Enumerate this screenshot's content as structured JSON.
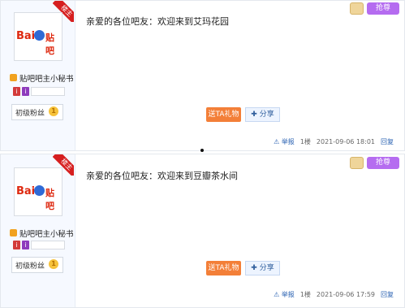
{
  "posts": [
    {
      "user_role_ribbon": "楼主",
      "avatar_logo": {
        "text1": "Bai",
        "text2": "贴吧"
      },
      "user_title": "贴吧吧主小秘书",
      "badges": [
        "i",
        "i"
      ],
      "rank": "初级粉丝",
      "rank_level": "1",
      "content": "亲爱的各位吧友：欢迎来到艾玛花园",
      "actions": {
        "gift": "送TA礼物",
        "share": "分享"
      },
      "footer": {
        "report": "举报",
        "floor": "1楼",
        "time": "2021-09-06 18:01",
        "reply": "回复"
      },
      "top_icons": {
        "vip": "抢尊"
      }
    },
    {
      "user_role_ribbon": "楼主",
      "avatar_logo": {
        "text1": "Bai",
        "text2": "贴吧"
      },
      "user_title": "贴吧吧主小秘书",
      "badges": [
        "i",
        "i"
      ],
      "rank": "初级粉丝",
      "rank_level": "1",
      "content": "亲爱的各位吧友：欢迎来到豆瓣茶水间",
      "actions": {
        "gift": "送TA礼物",
        "share": "分享"
      },
      "footer": {
        "report": "举报",
        "floor": "1楼",
        "time": "2021-09-06 17:59",
        "reply": "回复"
      },
      "top_icons": {
        "vip": "抢尊"
      }
    }
  ],
  "colors": {
    "ribbon": "#d61f1f",
    "gift_button": "#f37f38",
    "link": "#2d64b3"
  }
}
